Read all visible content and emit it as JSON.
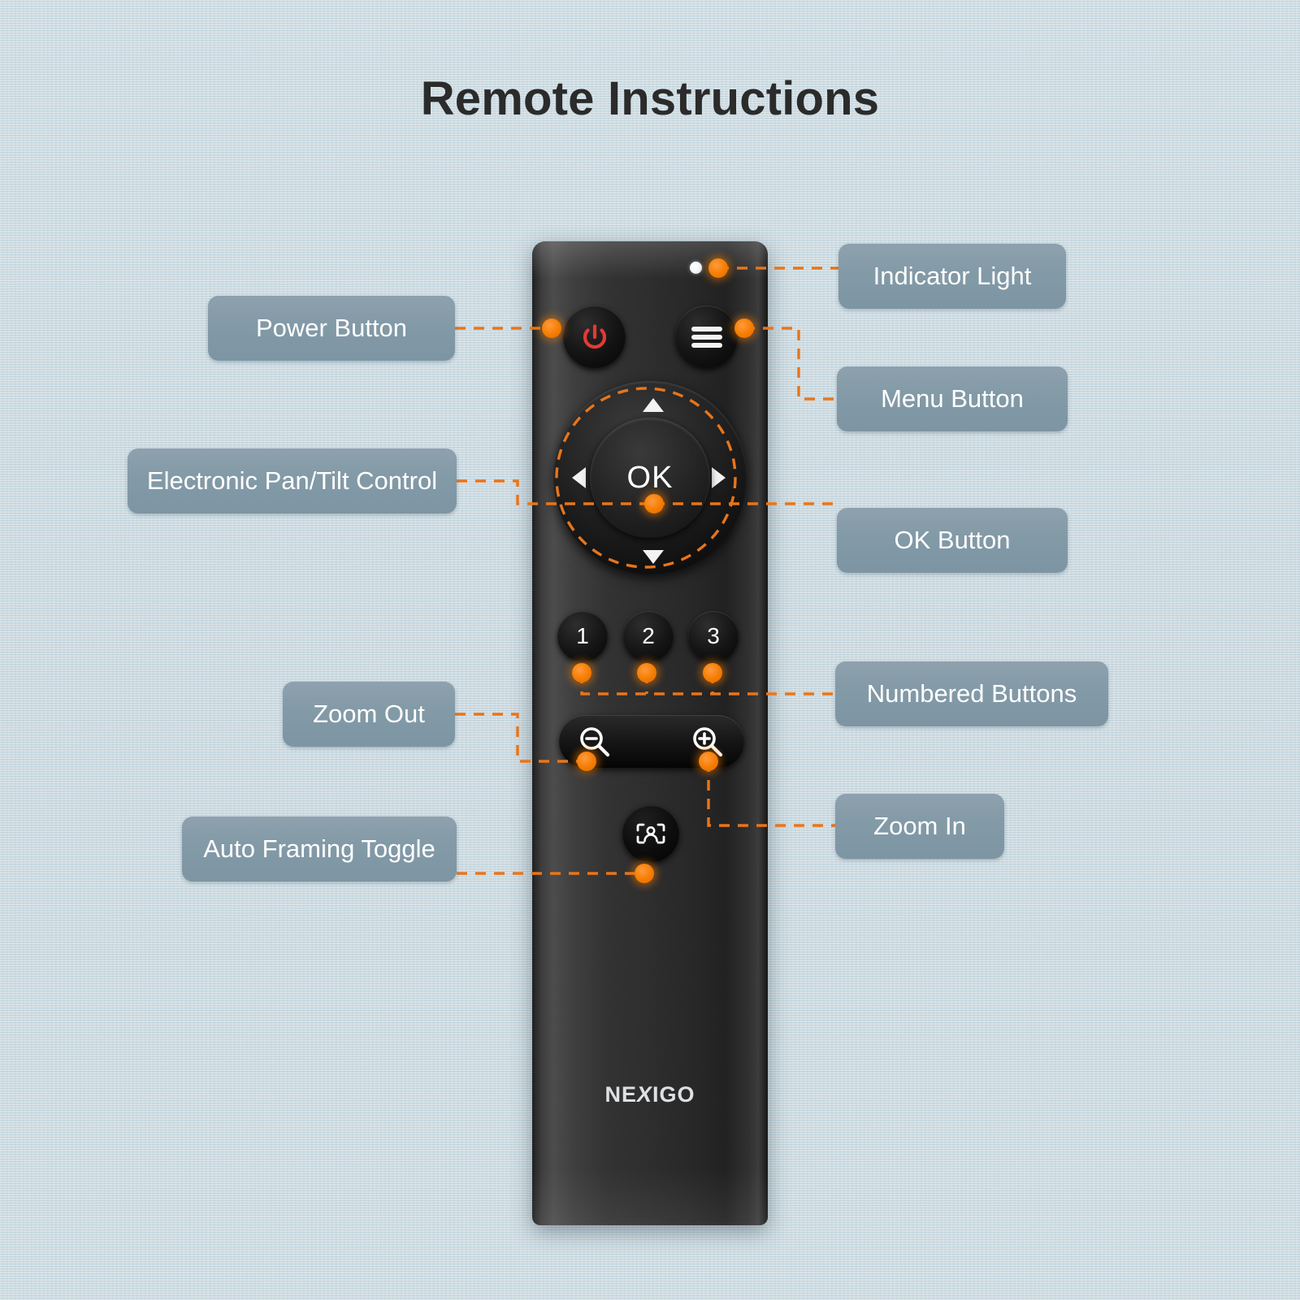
{
  "page": {
    "title": "Remote Instructions",
    "background_color": "#cbdae1",
    "accent_color": "#e8751a",
    "label_color": "#839aa7",
    "label_text_color": "#ffffff"
  },
  "remote": {
    "brand": "NexiGo",
    "indicator_led": "indicator-light",
    "power_icon": "power-icon",
    "menu_icon": "hamburger-menu-icon",
    "ok_label": "OK",
    "dpad_arrows": [
      "up",
      "down",
      "left",
      "right"
    ],
    "number_buttons": [
      "1",
      "2",
      "3"
    ],
    "zoom_out_icon": "magnifier-minus-icon",
    "zoom_in_icon": "magnifier-plus-icon",
    "auto_framing_icon": "person-in-frame-icon"
  },
  "callouts": [
    {
      "id": "power-button",
      "label": "Power Button",
      "side": "left"
    },
    {
      "id": "pan-tilt-control",
      "label": "Electronic Pan/Tilt Control",
      "side": "left"
    },
    {
      "id": "zoom-out",
      "label": "Zoom Out",
      "side": "left"
    },
    {
      "id": "auto-framing",
      "label": "Auto Framing Toggle",
      "side": "left"
    },
    {
      "id": "indicator-light",
      "label": "Indicator Light",
      "side": "right"
    },
    {
      "id": "menu-button",
      "label": "Menu Button",
      "side": "right"
    },
    {
      "id": "ok-button",
      "label": "OK Button",
      "side": "right"
    },
    {
      "id": "numbered-buttons",
      "label": "Numbered Buttons",
      "side": "right"
    },
    {
      "id": "zoom-in",
      "label": "Zoom In",
      "side": "right"
    }
  ]
}
